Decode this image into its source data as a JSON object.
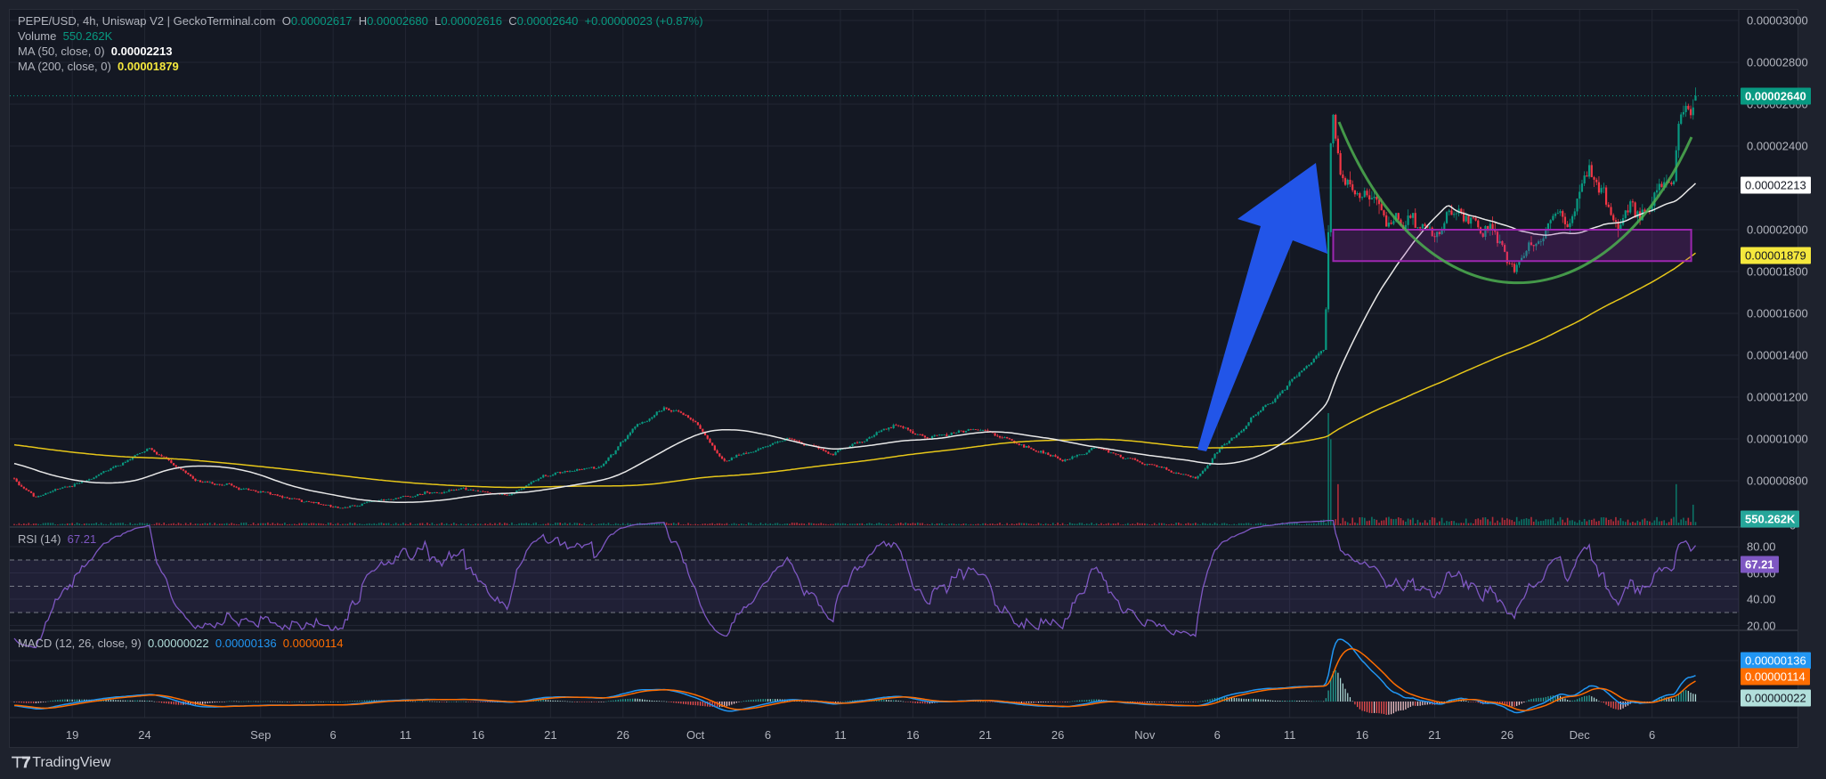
{
  "legend": {
    "symbol": "PEPE/USD, 4h, Uniswap V2 | GeckoTerminal.com",
    "o_label": "O",
    "o": "0.00002617",
    "h_label": "H",
    "h": "0.00002680",
    "l_label": "L",
    "l": "0.00002616",
    "c_label": "C",
    "c": "0.00002640",
    "change": "+0.00000023 (+0.87%)",
    "volume_label": "Volume",
    "volume": "550.262K",
    "ma50_label": "MA (50, close, 0)",
    "ma50": "0.00002213",
    "ma200_label": "MA (200, close, 0)",
    "ma200": "0.00001879",
    "rsi_label": "RSI (14)",
    "rsi": "67.21",
    "macd_label": "MACD (12, 26, close, 9)",
    "macd_hist": "0.00000022",
    "macd_line": "0.00000136",
    "macd_signal": "0.00000114"
  },
  "price_axis": [
    "0.00003000",
    "0.00002800",
    "0.00002600",
    "0.00002400",
    "0.00002200",
    "0.00002000",
    "0.00001800",
    "0.00001600",
    "0.00001400",
    "0.00001200",
    "0.00001000",
    "0.00000800"
  ],
  "price_axis_values": [
    3000,
    2800,
    2600,
    2400,
    2200,
    2000,
    1800,
    1600,
    1400,
    1200,
    1000,
    800
  ],
  "volume_axis": "0",
  "rsi_axis": [
    "80.00",
    "60.00",
    "40.00",
    "20.00"
  ],
  "rsi_axis_values": [
    80,
    60,
    40,
    20
  ],
  "badges": {
    "last_price": "0.00002640",
    "ma50": "0.00002213",
    "ma200": "0.00001879",
    "volume": "550.262K",
    "rsi": "67.21",
    "macd_line": "0.00000136",
    "macd_signal": "0.00000114",
    "macd_hist": "0.00000022"
  },
  "time_axis": [
    {
      "label": "19",
      "day": 4
    },
    {
      "label": "24",
      "day": 9
    },
    {
      "label": "Sep",
      "day": 17
    },
    {
      "label": "6",
      "day": 22
    },
    {
      "label": "11",
      "day": 27
    },
    {
      "label": "16",
      "day": 32
    },
    {
      "label": "21",
      "day": 37
    },
    {
      "label": "26",
      "day": 42
    },
    {
      "label": "Oct",
      "day": 47
    },
    {
      "label": "6",
      "day": 52
    },
    {
      "label": "11",
      "day": 57
    },
    {
      "label": "16",
      "day": 62
    },
    {
      "label": "21",
      "day": 67
    },
    {
      "label": "26",
      "day": 72
    },
    {
      "label": "Nov",
      "day": 78
    },
    {
      "label": "6",
      "day": 83
    },
    {
      "label": "11",
      "day": 88
    },
    {
      "label": "16",
      "day": 93
    },
    {
      "label": "21",
      "day": 98
    },
    {
      "label": "26",
      "day": 103
    },
    {
      "label": "Dec",
      "day": 108
    },
    {
      "label": "6",
      "day": 113
    }
  ],
  "colors": {
    "up": "#089981",
    "down": "#f23645",
    "ma50": "#e8e8e8",
    "ma200": "#e6c619",
    "rsi": "#7e57c2",
    "macd": "#2196f3",
    "signal": "#ff6d00",
    "arrow": "#2255e8",
    "zone": "#9c27b0",
    "cup": "#4caf50"
  },
  "footer": {
    "brand": "TradingView"
  },
  "chart_data": {
    "type": "candlestick",
    "title": "PEPE/USD, 4h, Uniswap V2",
    "units": "price in 1e-8 USD",
    "day0": "Aug 15",
    "ylim": [
      700,
      3050
    ],
    "price_keypoints": [
      [
        -34,
        1060
      ],
      [
        -20,
        1000
      ],
      [
        -8,
        940
      ],
      [
        -1,
        840
      ],
      [
        0,
        811
      ],
      [
        1.4,
        727
      ],
      [
        5,
        800
      ],
      [
        9.4,
        950
      ],
      [
        12.6,
        800
      ],
      [
        17.4,
        744
      ],
      [
        22.6,
        671
      ],
      [
        27,
        727
      ],
      [
        31,
        766
      ],
      [
        34.1,
        727
      ],
      [
        36.5,
        822
      ],
      [
        40.5,
        867
      ],
      [
        42.9,
        1062
      ],
      [
        44.9,
        1146
      ],
      [
        46.9,
        1090
      ],
      [
        48.9,
        895
      ],
      [
        53.3,
        1006
      ],
      [
        56.5,
        934
      ],
      [
        60.9,
        1062
      ],
      [
        62.9,
        1006
      ],
      [
        66.8,
        1045
      ],
      [
        69.2,
        979
      ],
      [
        72.4,
        895
      ],
      [
        74.8,
        962
      ],
      [
        78.8,
        867
      ],
      [
        81.6,
        811
      ],
      [
        83.2,
        950
      ],
      [
        85.2,
        1090
      ],
      [
        87.6,
        1230
      ],
      [
        89.6,
        1370
      ],
      [
        90.4,
        1425
      ],
      [
        90.6,
        1816
      ],
      [
        90.9,
        2542
      ],
      [
        91.6,
        2263
      ],
      [
        94.7,
        2068
      ],
      [
        97.9,
        1984
      ],
      [
        99.9,
        2096
      ],
      [
        101.9,
        1957
      ],
      [
        103.5,
        1788
      ],
      [
        105.1,
        1957
      ],
      [
        107.5,
        2068
      ],
      [
        108.7,
        2263
      ],
      [
        110.7,
        2012
      ],
      [
        113.1,
        2152
      ],
      [
        114.5,
        2263
      ],
      [
        114.9,
        2654
      ],
      [
        116.1,
        2640
      ]
    ],
    "volume_spikes": [
      [
        90.6,
        3000000
      ],
      [
        90.9,
        2300000
      ],
      [
        91.3,
        1100000
      ],
      [
        114.6,
        1100000
      ],
      [
        115.8,
        550262
      ]
    ],
    "last": {
      "open": 2617,
      "high": 2680,
      "low": 2616,
      "close": 2640
    },
    "ma50_last": 2213,
    "ma200_last": 1879,
    "rsi_last": 67.21,
    "rsi_bands": [
      30,
      50,
      70
    ],
    "macd_last": {
      "macd": 136,
      "signal": 114,
      "hist": 22
    },
    "annotations": {
      "zone": [
        1850,
        2000
      ],
      "zone_days": [
        91,
        115.7
      ]
    }
  }
}
